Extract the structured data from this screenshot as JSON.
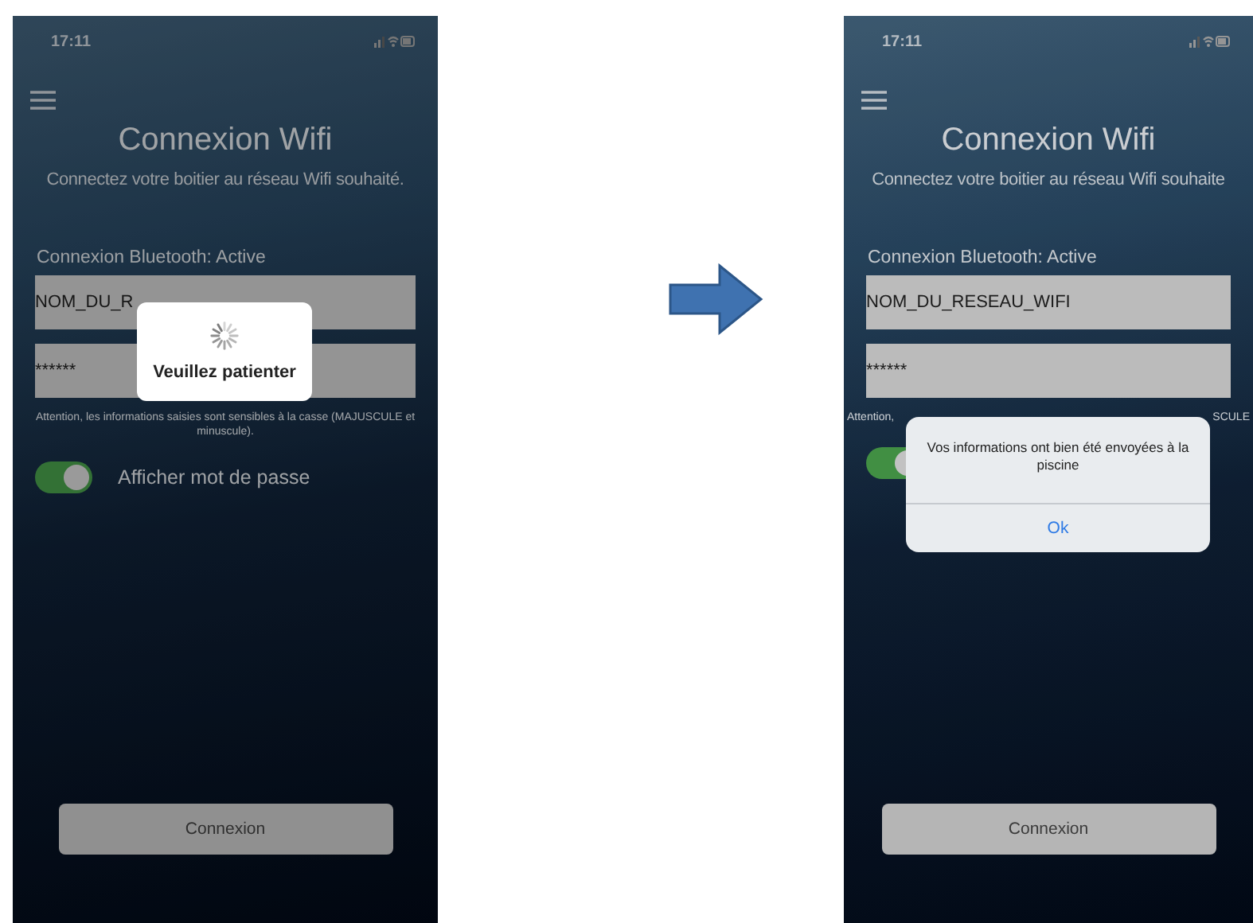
{
  "screens": [
    {
      "time": "17:11",
      "title": "Connexion Wifi",
      "subtitle": "Connectez votre boitier au réseau Wifi souhaité.",
      "bluetooth": "Connexion Bluetooth: Active",
      "network_field": "NOM_DU_R",
      "password_field": "******",
      "note_parts": [
        "Attention, les informations saisies sont sensibles à la casse (MAJUSCULE et minuscule)."
      ],
      "toggle": {
        "label": "Afficher mot de passe",
        "on": true
      },
      "button": "Connexion",
      "overlay": {
        "kind": "loading",
        "text": "Veuillez patienter"
      }
    },
    {
      "time": "17:11",
      "title": "Connexion Wifi",
      "subtitle": "Connectez votre boitier au réseau Wifi souhaite",
      "bluetooth": "Connexion Bluetooth: Active",
      "network_field": "NOM_DU_RESEAU_WIFI",
      "password_field": "******",
      "note_parts": [
        "Attention,",
        "SCULE"
      ],
      "toggle": {
        "on": true
      },
      "button": "Connexion",
      "overlay": {
        "kind": "alert",
        "text": "Vos informations ont bien été envoyées à la piscine",
        "action": "Ok"
      }
    }
  ]
}
